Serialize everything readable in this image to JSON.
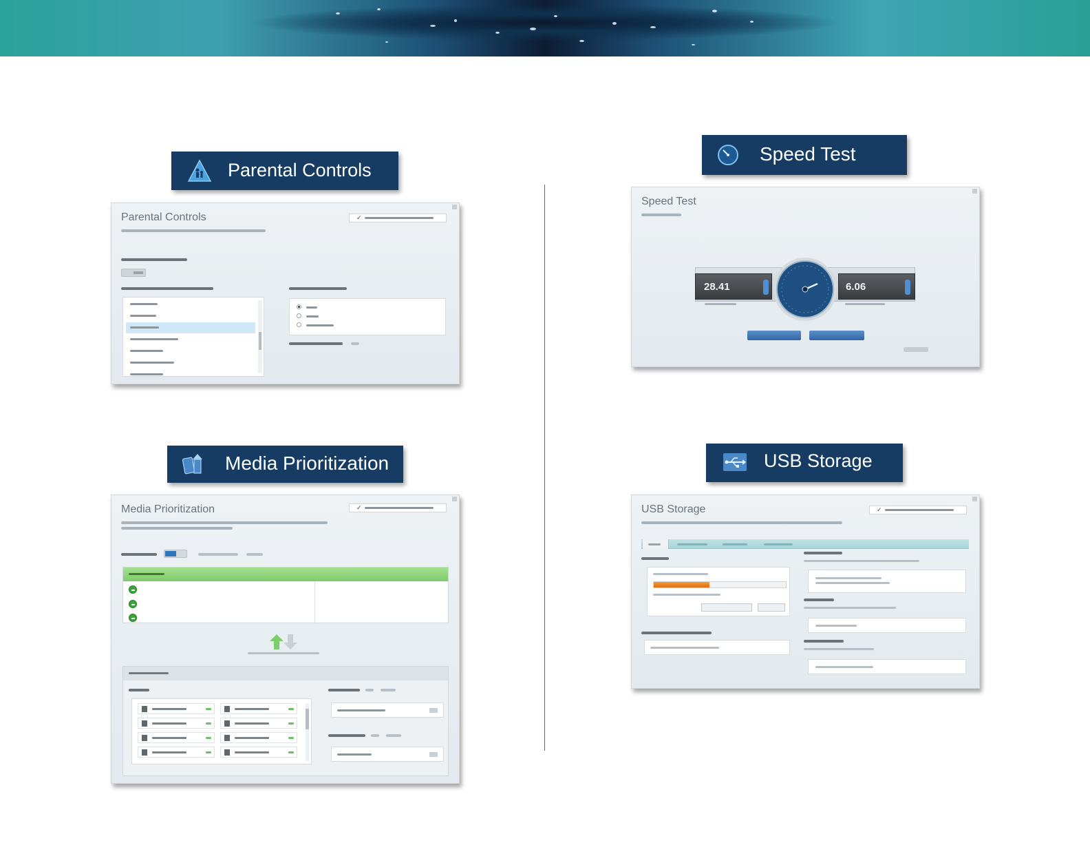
{
  "colors": {
    "title_tab_bg": "#163c64",
    "divider": "#3d6f9e",
    "accent_blue": "#2f66a6",
    "high_priority_green": "#8fd47f",
    "usb_progress_orange": "#e06d12"
  },
  "sections": {
    "parental_controls": {
      "tab_label": "Parental Controls",
      "icon": "parental-controls-triangle-icon",
      "panel_title": "Parental Controls"
    },
    "speed_test": {
      "tab_label": "Speed Test",
      "icon": "speedometer-icon",
      "panel_title": "Speed Test",
      "download_value": "28.41",
      "upload_value": "6.06"
    },
    "media_prioritization": {
      "tab_label": "Media Prioritization",
      "icon": "media-prioritization-arrows-icon",
      "panel_title": "Media Prioritization"
    },
    "usb_storage": {
      "tab_label": "USB Storage",
      "icon": "usb-icon",
      "panel_title": "USB Storage",
      "usage_fraction": 0.42
    }
  }
}
